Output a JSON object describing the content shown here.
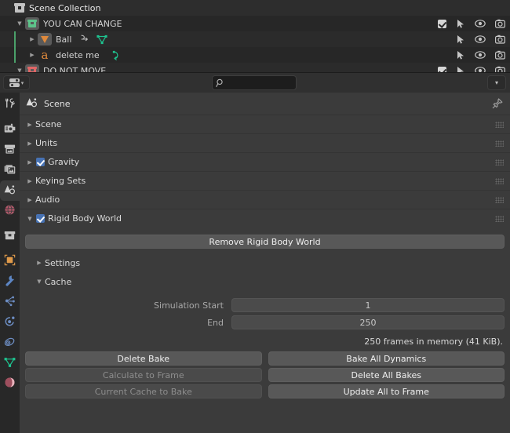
{
  "outliner": {
    "rows": [
      {
        "label": "Scene Collection",
        "icon": "collection-icon",
        "indent": 0,
        "disclosure": "",
        "has_checkbox": false,
        "right_icons": []
      },
      {
        "label": "YOU CAN CHANGE",
        "icon": "collection-icon-green",
        "indent": 1,
        "disclosure": "▼",
        "has_checkbox": true,
        "right_icons": [
          "cursor-select-icon",
          "eye-icon",
          "camera-icon"
        ]
      },
      {
        "label": "Ball",
        "icon": "mesh-object-icon",
        "indent": 2,
        "disclosure": "▶",
        "has_checkbox": false,
        "extra_icons": [
          "modifier-icon",
          "mesh-data-icon"
        ],
        "right_icons": [
          "cursor-select-icon",
          "eye-icon",
          "camera-icon"
        ]
      },
      {
        "label": "delete me",
        "icon": "font-object-icon",
        "indent": 2,
        "disclosure": "▶",
        "has_checkbox": false,
        "extra_icons": [
          "animation-data-icon"
        ],
        "right_icons": [
          "cursor-select-icon",
          "eye-icon",
          "camera-icon"
        ]
      },
      {
        "label": "DO NOT MOVE",
        "icon": "collection-icon-red",
        "indent": 1,
        "disclosure": "▼",
        "has_checkbox": true,
        "right_icons": [
          "cursor-select-icon",
          "eye-icon",
          "camera-icon"
        ]
      }
    ]
  },
  "properties_header": {
    "editor_type_icon": "properties-editor-icon",
    "editor_type_caret": "▾",
    "search_value": "",
    "search_placeholder": "",
    "search_icon": "search-icon",
    "filter_caret": "▾"
  },
  "nav_tabs": [
    {
      "name": "tool",
      "icon": "tool-icon",
      "active": false,
      "group": 0
    },
    {
      "name": "render",
      "icon": "render-camera-icon",
      "active": false,
      "group": 1
    },
    {
      "name": "output",
      "icon": "output-printer-icon",
      "active": false,
      "group": 1
    },
    {
      "name": "view-layer",
      "icon": "view-layer-images-icon",
      "active": false,
      "group": 1
    },
    {
      "name": "scene",
      "icon": "scene-cone-sphere-icon",
      "active": true,
      "group": 1
    },
    {
      "name": "world",
      "icon": "world-globe-icon",
      "active": false,
      "group": 1
    },
    {
      "name": "collection",
      "icon": "collection-box-icon",
      "active": false,
      "group": 2
    },
    {
      "name": "object",
      "icon": "object-square-icon",
      "active": false,
      "group": 3
    },
    {
      "name": "modifiers",
      "icon": "wrench-icon",
      "active": false,
      "group": 3
    },
    {
      "name": "particles",
      "icon": "particles-icon",
      "active": false,
      "group": 3
    },
    {
      "name": "physics",
      "icon": "physics-orbit-icon",
      "active": false,
      "group": 3
    },
    {
      "name": "constraints",
      "icon": "constraints-icon",
      "active": false,
      "group": 3
    },
    {
      "name": "object-data",
      "icon": "mesh-data-triangle-icon",
      "active": false,
      "group": 3
    },
    {
      "name": "material",
      "icon": "material-sphere-icon",
      "active": false,
      "group": 3
    }
  ],
  "breadcrumb": {
    "icon": "scene-cone-sphere-icon",
    "label": "Scene",
    "pin_icon": "pin-icon"
  },
  "panels": [
    {
      "label": "Scene",
      "open": false,
      "checkbox": null
    },
    {
      "label": "Units",
      "open": false,
      "checkbox": null
    },
    {
      "label": "Gravity",
      "open": false,
      "checkbox": true
    },
    {
      "label": "Keying Sets",
      "open": false,
      "checkbox": null
    },
    {
      "label": "Audio",
      "open": false,
      "checkbox": null
    },
    {
      "label": "Rigid Body World",
      "open": true,
      "checkbox": true
    }
  ],
  "rigid_body_world": {
    "remove_button": "Remove Rigid Body World",
    "subpanels": [
      {
        "label": "Settings",
        "open": false
      },
      {
        "label": "Cache",
        "open": true
      }
    ],
    "cache": {
      "fields": [
        {
          "label": "Simulation Start",
          "value": "1"
        },
        {
          "label": "End",
          "value": "250"
        }
      ],
      "info": "250 frames in memory (41 KiB).",
      "buttons": [
        {
          "label": "Delete Bake",
          "enabled": true
        },
        {
          "label": "Bake All Dynamics",
          "enabled": true
        },
        {
          "label": "Calculate to Frame",
          "enabled": false
        },
        {
          "label": "Delete All Bakes",
          "enabled": true
        },
        {
          "label": "Current Cache to Bake",
          "enabled": false
        },
        {
          "label": "Update All to Frame",
          "enabled": true
        }
      ]
    }
  },
  "colors": {
    "editor_bg": "#303030",
    "panel_bg": "#3b3b3b",
    "outliner_bg": "#282828",
    "nav_bg": "#282828",
    "accent_checkbox": "#4772b3",
    "collection_green": "#5dc38a",
    "collection_red": "#e06666",
    "object_orange": "#e08a3c",
    "mesh_teal": "#1ec490",
    "button_bg": "#585858",
    "button_disabled_text": "#8d8d8d"
  }
}
